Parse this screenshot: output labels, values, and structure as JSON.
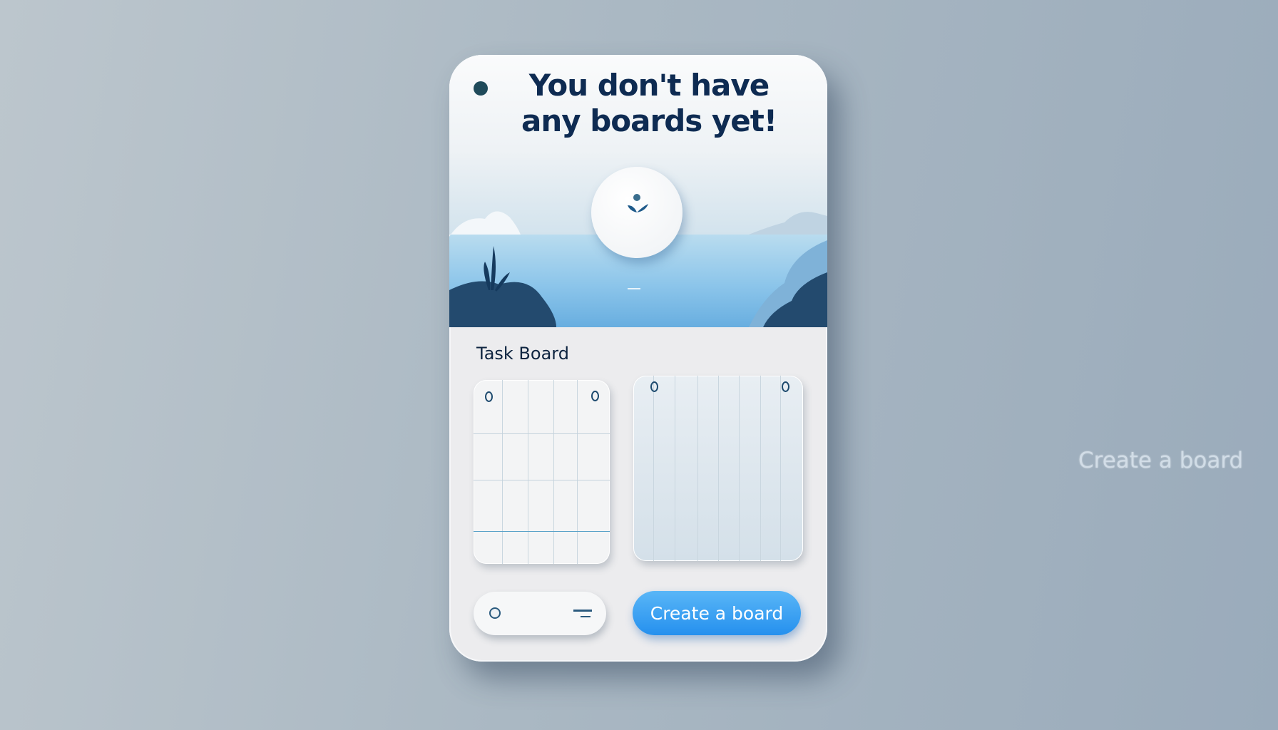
{
  "empty_state": {
    "title_line1": "You don't have",
    "title_line2": "any boards yet!"
  },
  "section": {
    "label": "Task Board"
  },
  "actions": {
    "create_button": "Create a board"
  },
  "side": {
    "create_link": "Create a board"
  },
  "colors": {
    "accent": "#2f9bf0",
    "title": "#0e2b52",
    "background": "#aab8c3"
  }
}
